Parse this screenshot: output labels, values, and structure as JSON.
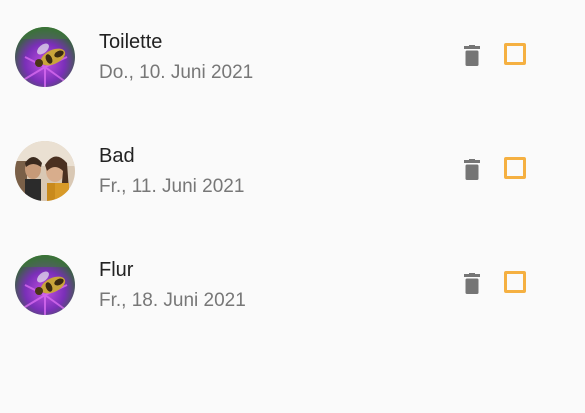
{
  "tasks": [
    {
      "title": "Toilette",
      "date": "Do., 10. Juni 2021",
      "avatar": "bee-on-flower-photo",
      "delete_icon": "trash-icon",
      "checked": false
    },
    {
      "title": "Bad",
      "date": "Fr., 11. Juni 2021",
      "avatar": "people-photo",
      "delete_icon": "trash-icon",
      "checked": false
    },
    {
      "title": "Flur",
      "date": "Fr., 18. Juni 2021",
      "avatar": "bee-on-flower-photo",
      "delete_icon": "trash-icon",
      "checked": false
    }
  ],
  "colors": {
    "checkbox_border": "#f5b041",
    "trash_icon": "#757575",
    "title_text": "#222222",
    "date_text": "#777777",
    "background": "#fafafa"
  }
}
